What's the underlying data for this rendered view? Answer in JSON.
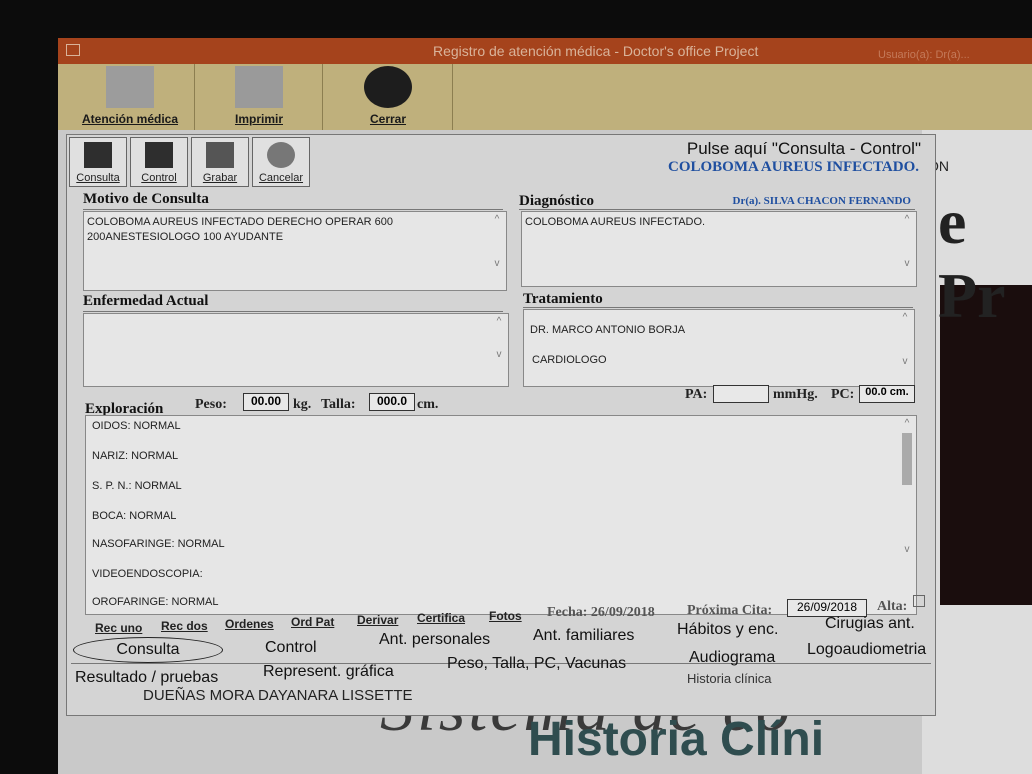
{
  "window": {
    "title": "Registro de atención médica - Doctor's office Project",
    "user": "Usuario(a): Dr(a)..."
  },
  "toolbar": [
    {
      "label": "Atención médica",
      "icon": "medical-care-icon"
    },
    {
      "label": "Imprimir",
      "icon": "printer-icon"
    },
    {
      "label": "Cerrar",
      "icon": "close-icon"
    }
  ],
  "dialog": {
    "actions": [
      {
        "label": "Consulta",
        "icon": "consulta-icon"
      },
      {
        "label": "Control",
        "icon": "control-icon"
      },
      {
        "label": "Grabar",
        "icon": "save-icon"
      },
      {
        "label": "Cancelar",
        "icon": "cancel-icon"
      }
    ],
    "hint": "Pulse aquí \"Consulta - Control\"",
    "diagnosis_header": "COLOBOMA AUREUS INFECTADO.",
    "doctor": "Dr(a). SILVA CHACON FERNANDO",
    "motivo": {
      "label": "Motivo de Consulta",
      "text": "COLOBOMA AUREUS INFECTADO DERECHO OPERAR 600 200ANESTESIOLOGO 100 AYUDANTE"
    },
    "diagnostico": {
      "label": "Diagnóstico",
      "text": "COLOBOMA AUREUS INFECTADO."
    },
    "enfermedad": {
      "label": "Enfermedad Actual",
      "text": ""
    },
    "tratamiento": {
      "label": "Tratamiento",
      "lines": [
        "DR. MARCO ANTONIO BORJA",
        "CARDIOLOGO"
      ]
    },
    "vitals": {
      "pa_label": "PA:",
      "pa_value": "",
      "mmhg": "mmHg.",
      "pc_label": "PC:",
      "pc_value": "00.0 cm."
    },
    "exploracion": {
      "label": "Exploración",
      "peso_label": "Peso:",
      "peso_value": "00.00",
      "kg": "kg.",
      "talla_label": "Talla:",
      "talla_value": "000.0",
      "cm": "cm.",
      "lines": [
        "OIDOS: NORMAL",
        "NARIZ: NORMAL",
        "S. P. N.: NORMAL",
        "BOCA: NORMAL",
        "NASOFARINGE: NORMAL",
        "VIDEOENDOSCOPIA:",
        "OROFARINGE: NORMAL"
      ]
    },
    "small_buttons": [
      "Rec uno",
      "Rec dos",
      "Ordenes",
      "Ord Pat",
      "Derivar",
      "Certifica",
      "Fotos"
    ],
    "fecha_label": "Fecha: 26/09/2018",
    "proxima_label": "Próxima Cita:",
    "proxima_value": "26/09/2018",
    "alta_label": "Alta:",
    "tabs_row1": [
      "Consulta",
      "Control",
      "Ant. personales",
      "Ant. familiares",
      "Hábitos y enc.",
      "Cirugias ant."
    ],
    "tabs_row2": [
      "Resultado / pruebas",
      "Represent. gráfica",
      "Peso, Talla, PC, Vacunas",
      "Audiograma",
      "Logoaudiometria"
    ],
    "patient": "DUEÑAS MORA DAYANARA LISSETTE",
    "historia_label": "Historia clínica"
  },
  "background": {
    "on_text": "ON",
    "pr_text": "e Pr",
    "sistema_text": "Sistema de co",
    "historia_text": "Historia Clíni"
  }
}
